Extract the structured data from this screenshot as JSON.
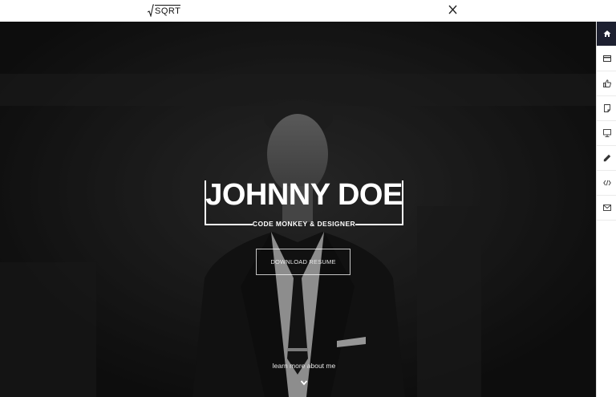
{
  "logo": {
    "text": "SQRT"
  },
  "hero": {
    "title": "JOHNNY DOE",
    "subtitle": "CODE MONKEY & DESIGNER",
    "download_label": "DOWNLOAD RESUME",
    "learn_more": "learn more about me"
  },
  "sidebar": {
    "items": [
      {
        "icon": "home-icon",
        "active": true
      },
      {
        "icon": "card-icon",
        "active": false
      },
      {
        "icon": "thumbs-up-icon",
        "active": false
      },
      {
        "icon": "document-icon",
        "active": false
      },
      {
        "icon": "monitor-icon",
        "active": false
      },
      {
        "icon": "pencil-icon",
        "active": false
      },
      {
        "icon": "code-icon",
        "active": false
      },
      {
        "icon": "envelope-icon",
        "active": false
      }
    ]
  },
  "colors": {
    "sidebar_active": "#1d2030",
    "hero_overlay": "#1c1c1c",
    "text_light": "#ffffff"
  }
}
